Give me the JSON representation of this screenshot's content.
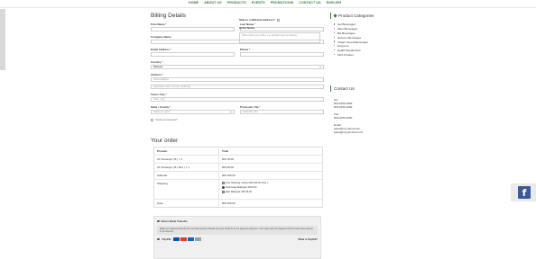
{
  "nav": {
    "items": [
      "HOME",
      "ABOUT US",
      "PRODUCTS",
      "EVENTS",
      "PROMOTIONS",
      "CONTACT US",
      "ENGLISH"
    ]
  },
  "billing": {
    "title": "Billing Details",
    "first_name_label": "First Name",
    "last_name_label": "Last Name",
    "company_label": "Company Name",
    "email_label": "Email Address",
    "phone_label": "Phone",
    "country_label": "Country",
    "country_value": "Malaysia",
    "address_label": "Address",
    "address_placeholder": "Street address",
    "address2_placeholder": "Apartment, suite, unit etc. (optional)",
    "town_label": "Town / City",
    "town_placeholder": "Town / City",
    "state_label": "State / County",
    "state_value": "Select an option...",
    "postcode_label": "Postcode / Zip",
    "postcode_placeholder": "Postcode / Zip",
    "create_account_label": "Create an account?",
    "required_mark": "*"
  },
  "shipping": {
    "ship_different_label": "Ship to a different address?",
    "order_notes_label": "Order Notes",
    "order_notes_placeholder": "Notes about your order, e.g. special notes for delivery."
  },
  "order": {
    "title": "Your order",
    "head_product": "Product",
    "head_total": "Total",
    "items": [
      {
        "name": "Oil Tendergé | B | × 1",
        "total": "RM 78.00"
      },
      {
        "name": "Oil Tendergé | B | Rec | × 1",
        "total": "RM 28.00"
      }
    ],
    "subtotal_label": "Subtotal",
    "subtotal_value": "RM 106.00",
    "shipping_label": "Shipping",
    "shipping_options": [
      {
        "label": "Free Shipping ( Above RM 199.00 Only ):",
        "selected": false
      },
      {
        "label": "Peninsular Malaysia: RM 8.00",
        "selected": true
      },
      {
        "label": "East Malaysia: RM 15.00",
        "selected": false
      }
    ],
    "total_label": "Total",
    "total_value": "RM 106.00"
  },
  "payment": {
    "bank_label": "Direct Bank Transfer",
    "bank_note": "Make your payment directly into our bank account. Please use your Order ID as the payment reference. Your order won't be shipped until the funds have cleared in our account.",
    "paypal_label": "PayPal",
    "what_is_paypal": "What is PayPal?"
  },
  "sidebar": {
    "categories_title": "Product Categories",
    "categories": [
      "Gel Beverages",
      "Fiber Beverages",
      "Bio Beverages",
      "Enzyme Beverages",
      "Instant Cereal Beverages",
      "Enzymes",
      "Health Supplement",
      "Kid's Product"
    ],
    "contact_title": "Contact Us",
    "tel_label": "Tel:",
    "tel_values": [
      "603-6156-1000",
      "603-6156-1000"
    ],
    "fax_label": "Fax:",
    "fax_values": [
      "603-6156-2000"
    ],
    "email_label": "Email:",
    "email_values": [
      "sales@my-bfood.com",
      "sales@my-jbmfood.com"
    ]
  },
  "colors": {
    "brand_green": "#2e7d32",
    "facebook": "#3b5998"
  }
}
